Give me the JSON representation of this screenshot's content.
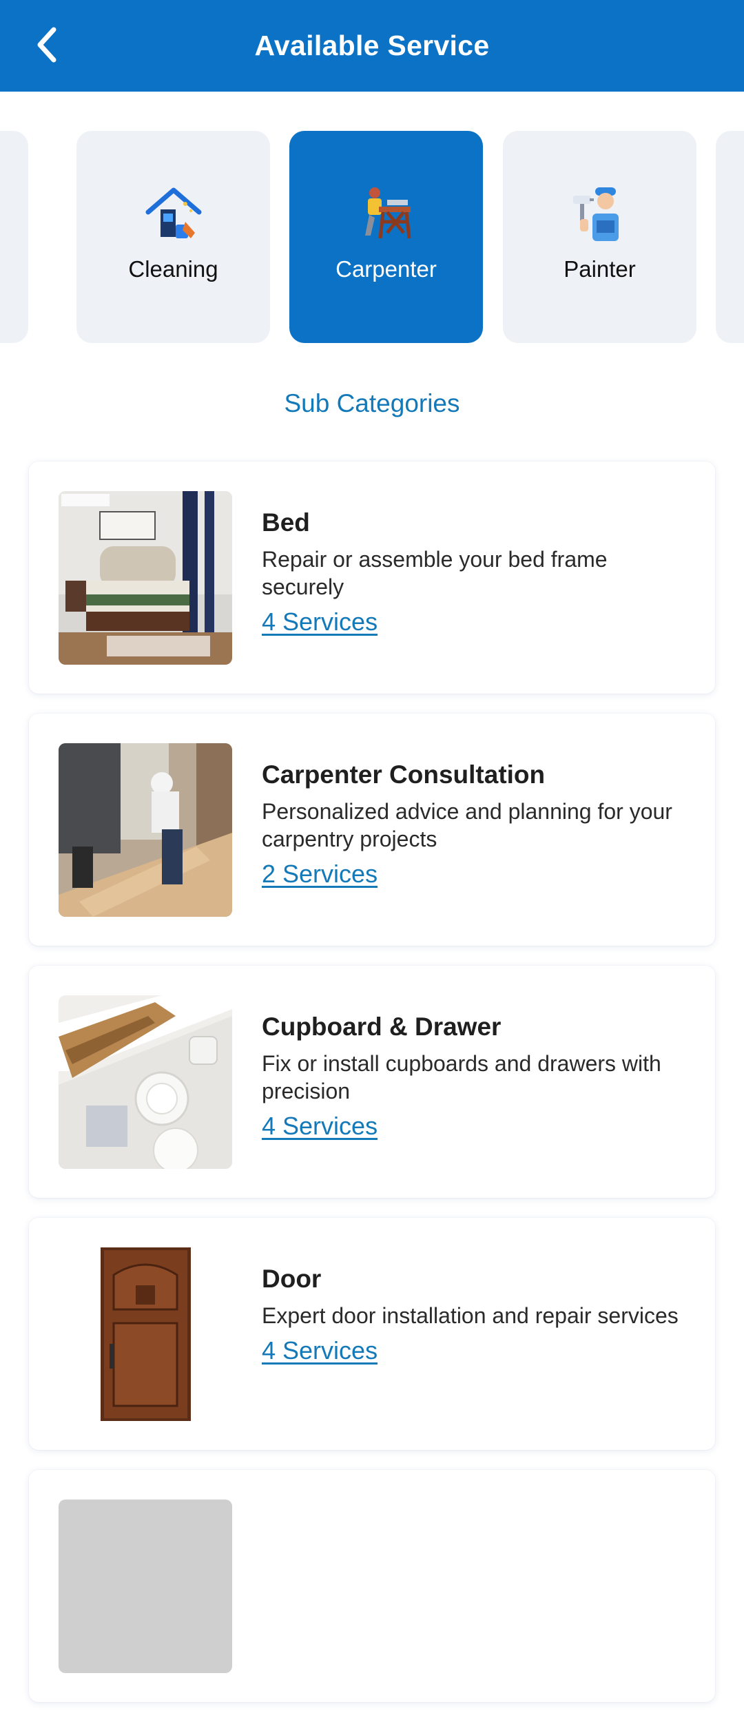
{
  "header": {
    "title": "Available Service",
    "back_icon": "chevron-left-icon",
    "background": "#0b72c5"
  },
  "categories": [
    {
      "label": "",
      "icon": "partial-card",
      "active": false
    },
    {
      "label": "Cleaning",
      "icon": "cleaning-house-icon",
      "active": false
    },
    {
      "label": "Carpenter",
      "icon": "carpenter-icon",
      "active": true
    },
    {
      "label": "Painter",
      "icon": "painter-icon",
      "active": false
    },
    {
      "label": "",
      "icon": "partial-card",
      "active": false
    }
  ],
  "sub_heading": "Sub Categories",
  "subcategories": [
    {
      "title": "Bed",
      "description": "Repair or assemble your bed frame securely",
      "link": "4 Services",
      "image": "bedroom-photo"
    },
    {
      "title": "Carpenter Consultation",
      "description": "Personalized advice and planning for your carpentry projects",
      "link": "2 Services",
      "image": "carpenter-working-photo"
    },
    {
      "title": "Cupboard & Drawer",
      "description": "Fix or install cupboards and drawers with precision",
      "link": "4 Services",
      "image": "drawer-photo"
    },
    {
      "title": "Door",
      "description": "Expert door installation and repair services",
      "link": "4 Services",
      "image": "wooden-door-photo"
    }
  ],
  "colors": {
    "accent": "#0b72c5",
    "link": "#1479b8",
    "card_inactive": "#eef1f6"
  }
}
